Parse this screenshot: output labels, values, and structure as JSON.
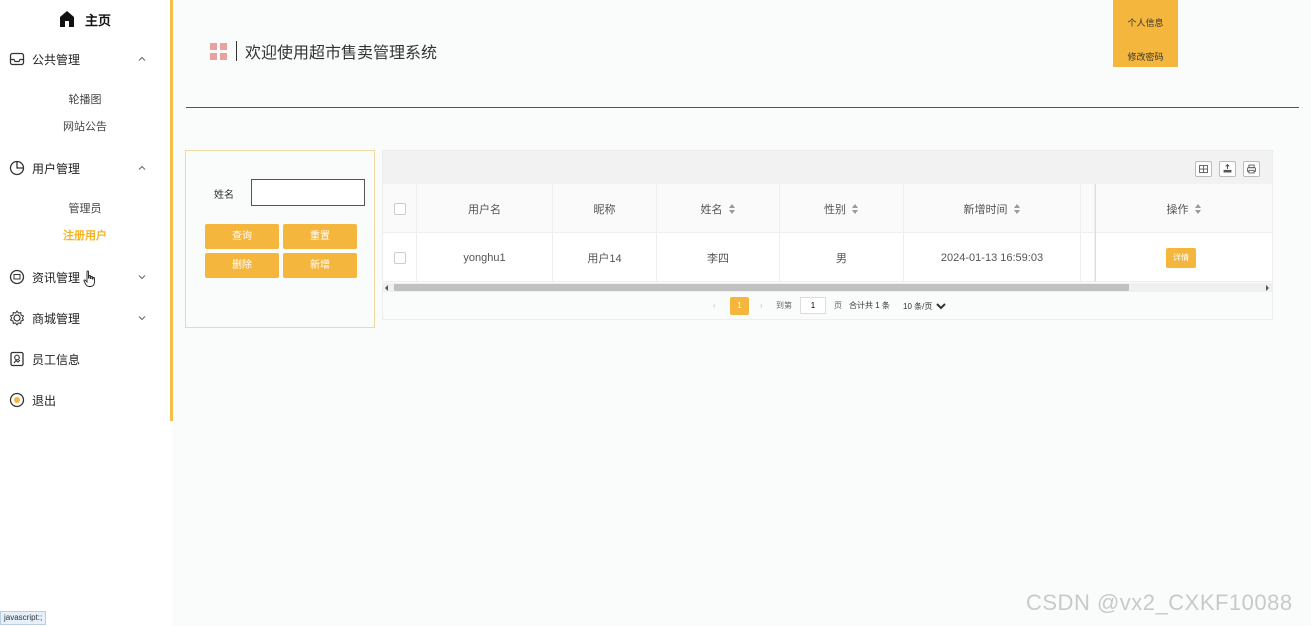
{
  "sidebar": {
    "home_label": "主页",
    "groups": [
      {
        "label": "公共管理",
        "icon": "inbox-icon",
        "expanded": true
      },
      {
        "label": "用户管理",
        "icon": "pie-chart-icon",
        "expanded": true
      },
      {
        "label": "资讯管理",
        "icon": "message-icon",
        "expanded": false
      },
      {
        "label": "商城管理",
        "icon": "gear-icon",
        "expanded": false
      },
      {
        "label": "员工信息",
        "icon": "badge-icon",
        "expanded": false
      },
      {
        "label": "退出",
        "icon": "power-icon",
        "expanded": false
      }
    ],
    "sub_items": {
      "public": [
        "轮播图",
        "网站公告"
      ],
      "users": [
        "管理员",
        "注册用户"
      ]
    },
    "active_sub_item": "注册用户"
  },
  "header": {
    "title": "欢迎使用超市售卖管理系统",
    "profile_label": "个人信息",
    "change_password_label": "修改密码"
  },
  "search": {
    "name_label": "姓名",
    "name_value": "",
    "query_label": "查询",
    "reset_label": "重置",
    "delete_label": "删除",
    "add_label": "新增"
  },
  "table": {
    "columns": [
      "用户名",
      "昵称",
      "姓名",
      "性别",
      "新增时间",
      "操作"
    ],
    "rows": [
      {
        "username": "yonghu1",
        "nickname": "用户14",
        "name": "李四",
        "gender": "男",
        "created": "2024-01-13 16:59:03",
        "action": "详情"
      }
    ]
  },
  "pagination": {
    "current_page": "1",
    "goto_label": "到第",
    "goto_value": "1",
    "page_suffix": "页",
    "total_label": "合计共 1 条",
    "page_size": "10 条/页"
  },
  "status_bar_text": "javascript:;",
  "watermark": "CSDN @vx2_CXKF10088",
  "colors": {
    "accent": "#f5b63e",
    "active_text": "#f5b323",
    "grid_icon": "#e8a1a1"
  }
}
